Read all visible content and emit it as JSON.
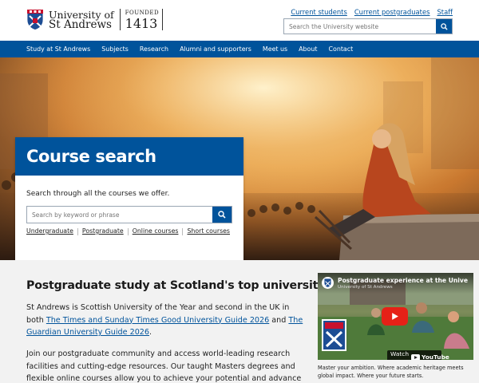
{
  "header": {
    "logo_line1": "University of",
    "logo_line2": "St Andrews",
    "founded_label": "FOUNDED",
    "founded_year": "1413",
    "quick_links": [
      "Current students",
      "Current postgraduates",
      "Staff"
    ],
    "search_placeholder": "Search the University website"
  },
  "nav": {
    "items": [
      "Study at St Andrews",
      "Subjects",
      "Research",
      "Alumni and supporters",
      "Meet us",
      "About",
      "Contact"
    ]
  },
  "hero": {
    "card_title": "Course search",
    "card_subtitle": "Search through all the courses we offer.",
    "search_placeholder": "Search by keyword or phrase",
    "links": [
      "Undergraduate",
      "Postgraduate",
      "Online courses",
      "Short courses"
    ]
  },
  "postgrad": {
    "title": "Postgraduate study at Scotland's top university",
    "p1_before": "St Andrews is Scottish University of the Year and second in the UK in both ",
    "p1_link1": "The Times and Sunday Times Good University Guide 2026",
    "p1_mid": " and ",
    "p1_link2": "The Guardian University Guide 2026",
    "p1_after": ".",
    "p2": "Join our postgraduate community and access world-leading research facilities and cutting-edge resources. Our taught Masters degrees and flexible online courses allow you to achieve your potential and advance"
  },
  "video": {
    "title": "Postgraduate experience at the Unive",
    "channel": "University of St Andrews",
    "watch_on": "Watch on",
    "youtube": "YouTube",
    "caption": "Master your ambition. Where academic heritage meets global impact. Where your future starts."
  },
  "colors": {
    "brand_blue": "#00539b",
    "nav_text": "#ffffff",
    "lower_bg": "#f2f2f2"
  },
  "icons": {
    "crest": "university-crest-icon",
    "search": "search-icon",
    "play": "play-icon",
    "youtube": "youtube-icon"
  }
}
